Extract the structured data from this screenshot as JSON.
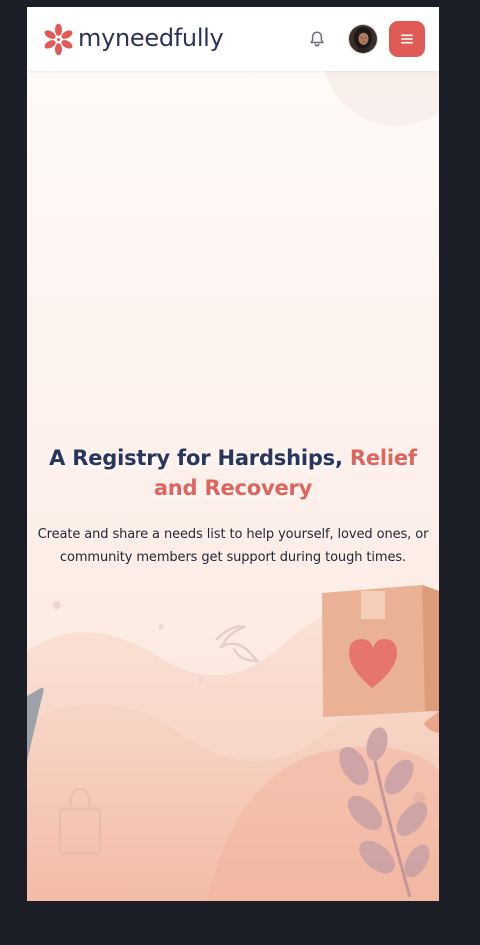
{
  "header": {
    "logo_text": "myneedfully",
    "logo_icon": "asterisk-flower-icon",
    "notification_icon": "bell-icon",
    "avatar_alt": "user-avatar",
    "menu_icon": "hamburger-icon"
  },
  "hero": {
    "headline_part1": "A Registry for Hardships,",
    "headline_accent": "Relief and Recovery",
    "subtitle": "Create and share a needs list to help yourself, loved ones, or community members get support during tough times."
  },
  "colors": {
    "brand": "#e05a55",
    "accent_text": "#e0645e",
    "headline": "#27365c",
    "page_background": "#1b1e27"
  }
}
